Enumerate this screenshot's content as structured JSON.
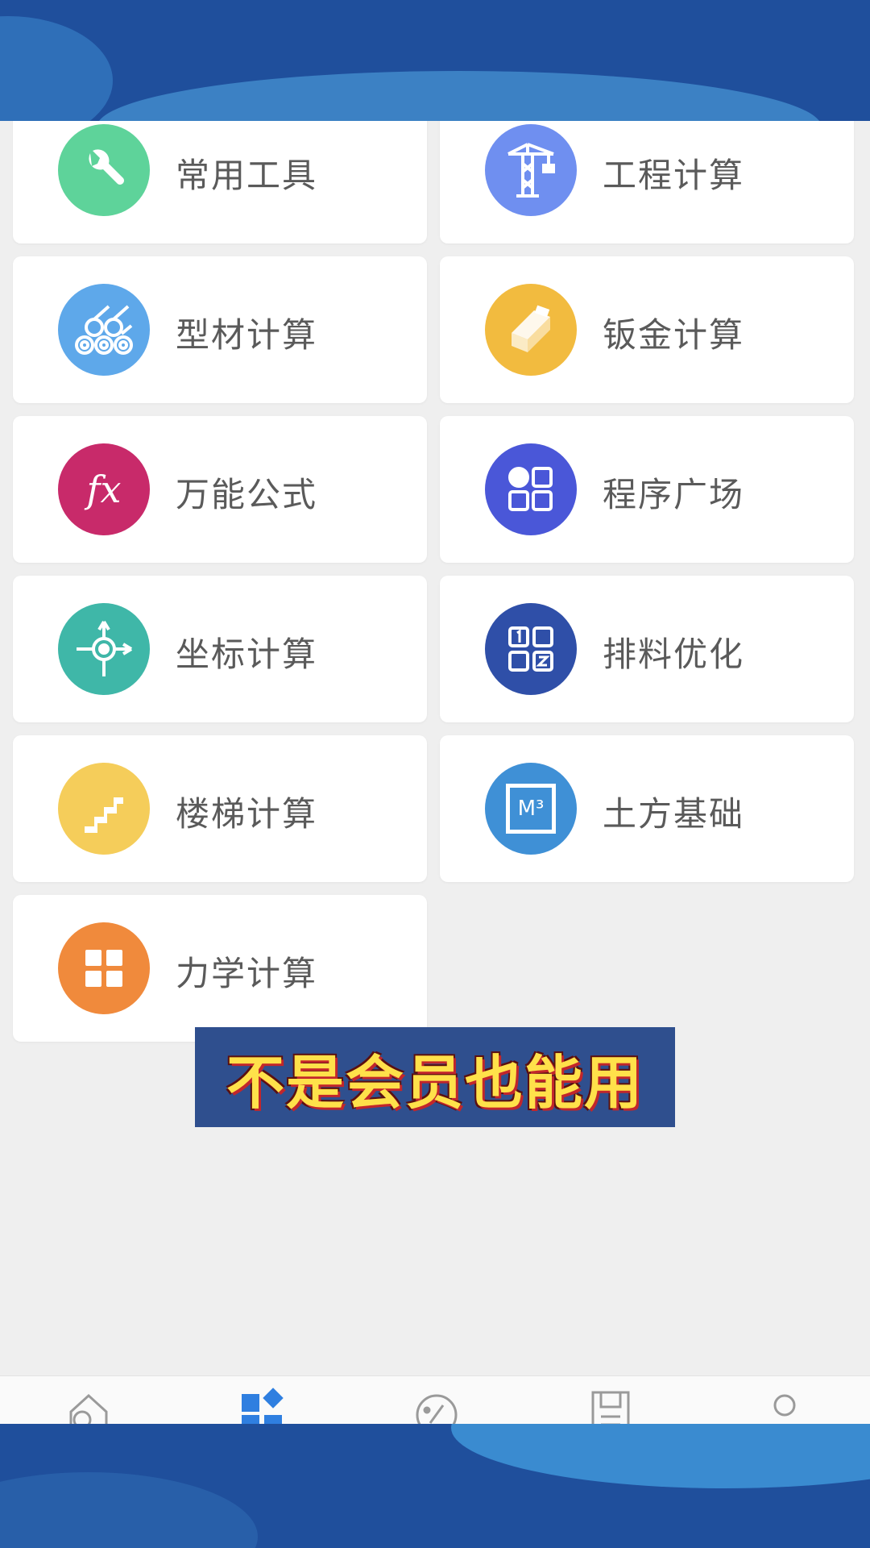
{
  "menu": {
    "items": [
      {
        "label": "常用工具",
        "icon": "wrench-icon",
        "color": "#5ed39a"
      },
      {
        "label": "工程计算",
        "icon": "crane-icon",
        "color": "#6f8ff0"
      },
      {
        "label": "型材计算",
        "icon": "pipes-icon",
        "color": "#5ea8ea"
      },
      {
        "label": "钣金计算",
        "icon": "sheet-metal-icon",
        "color": "#f2bb3f"
      },
      {
        "label": "万能公式",
        "icon": "fx-icon",
        "color": "#c82a6a"
      },
      {
        "label": "程序广场",
        "icon": "apps-icon",
        "color": "#4a57d8"
      },
      {
        "label": "坐标计算",
        "icon": "coordinate-icon",
        "color": "#3fb7a8"
      },
      {
        "label": "排料优化",
        "icon": "layout-grid-icon",
        "color": "#2f4fa8"
      },
      {
        "label": "楼梯计算",
        "icon": "stairs-icon",
        "color": "#f5cd5a"
      },
      {
        "label": "土方基础",
        "icon": "cubic-meter-icon",
        "color": "#3f90d6"
      },
      {
        "label": "力学计算",
        "icon": "mechanics-icon",
        "color": "#f08a3c"
      }
    ]
  },
  "fx_text": "fx",
  "m3_text": "M³",
  "subtitle_text": "不是会员也能用",
  "tabbar": {
    "tabs": [
      "home-icon",
      "category-icon",
      "explore-icon",
      "notes-icon",
      "profile-icon"
    ],
    "active_color": "#2f7fe0",
    "inactive_color": "#9a9a9a"
  }
}
